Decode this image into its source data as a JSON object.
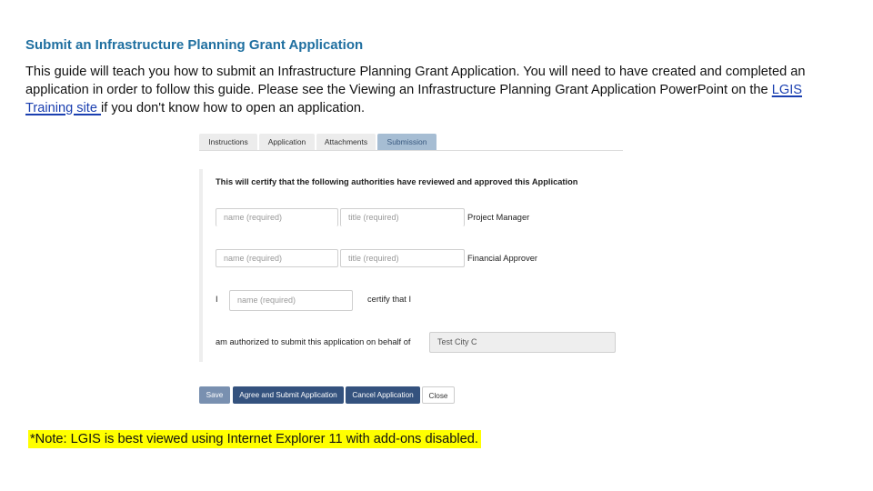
{
  "slide": {
    "title": "Submit an Infrastructure Planning Grant Application",
    "intro_before_link": "This guide will teach you how to submit an Infrastructure Planning Grant Application. You will need to have created and completed an application in order to follow this guide. Please see the Viewing an Infrastructure Planning Grant Application PowerPoint on the ",
    "link_text": "LGIS Training site ",
    "intro_after_link": "if you don't know how to open an application.",
    "note": "*Note: LGIS is best viewed using Internet Explorer 11 with add-ons disabled."
  },
  "app": {
    "tabs": [
      {
        "label": "Instructions",
        "active": false
      },
      {
        "label": "Application",
        "active": false
      },
      {
        "label": "Attachments",
        "active": false
      },
      {
        "label": "Submission",
        "active": true
      }
    ],
    "certify_heading": "This will certify that the following authorities have reviewed and approved this Application",
    "rows": [
      {
        "name_placeholder": "name (required)",
        "title_placeholder": "title (required)",
        "role": "Project Manager"
      },
      {
        "name_placeholder": "name (required)",
        "title_placeholder": "title (required)",
        "role": "Financial Approver"
      }
    ],
    "certify_prefix": "I",
    "certify_name_placeholder": "name (required)",
    "certify_suffix": "certify that I",
    "authorized_label": "am authorized to submit this application on behalf of",
    "behalf_value": "Test City C",
    "buttons": {
      "save": "Save",
      "agree_submit": "Agree and Submit Application",
      "cancel": "Cancel Application",
      "close": "Close"
    }
  },
  "colors": {
    "title": "#1f6fa0",
    "link": "#1a3fb0",
    "active_tab": "#a6bdd3",
    "primary_button": "#34527e",
    "save_button": "#7990b0",
    "note_highlight": "#ffff00"
  }
}
